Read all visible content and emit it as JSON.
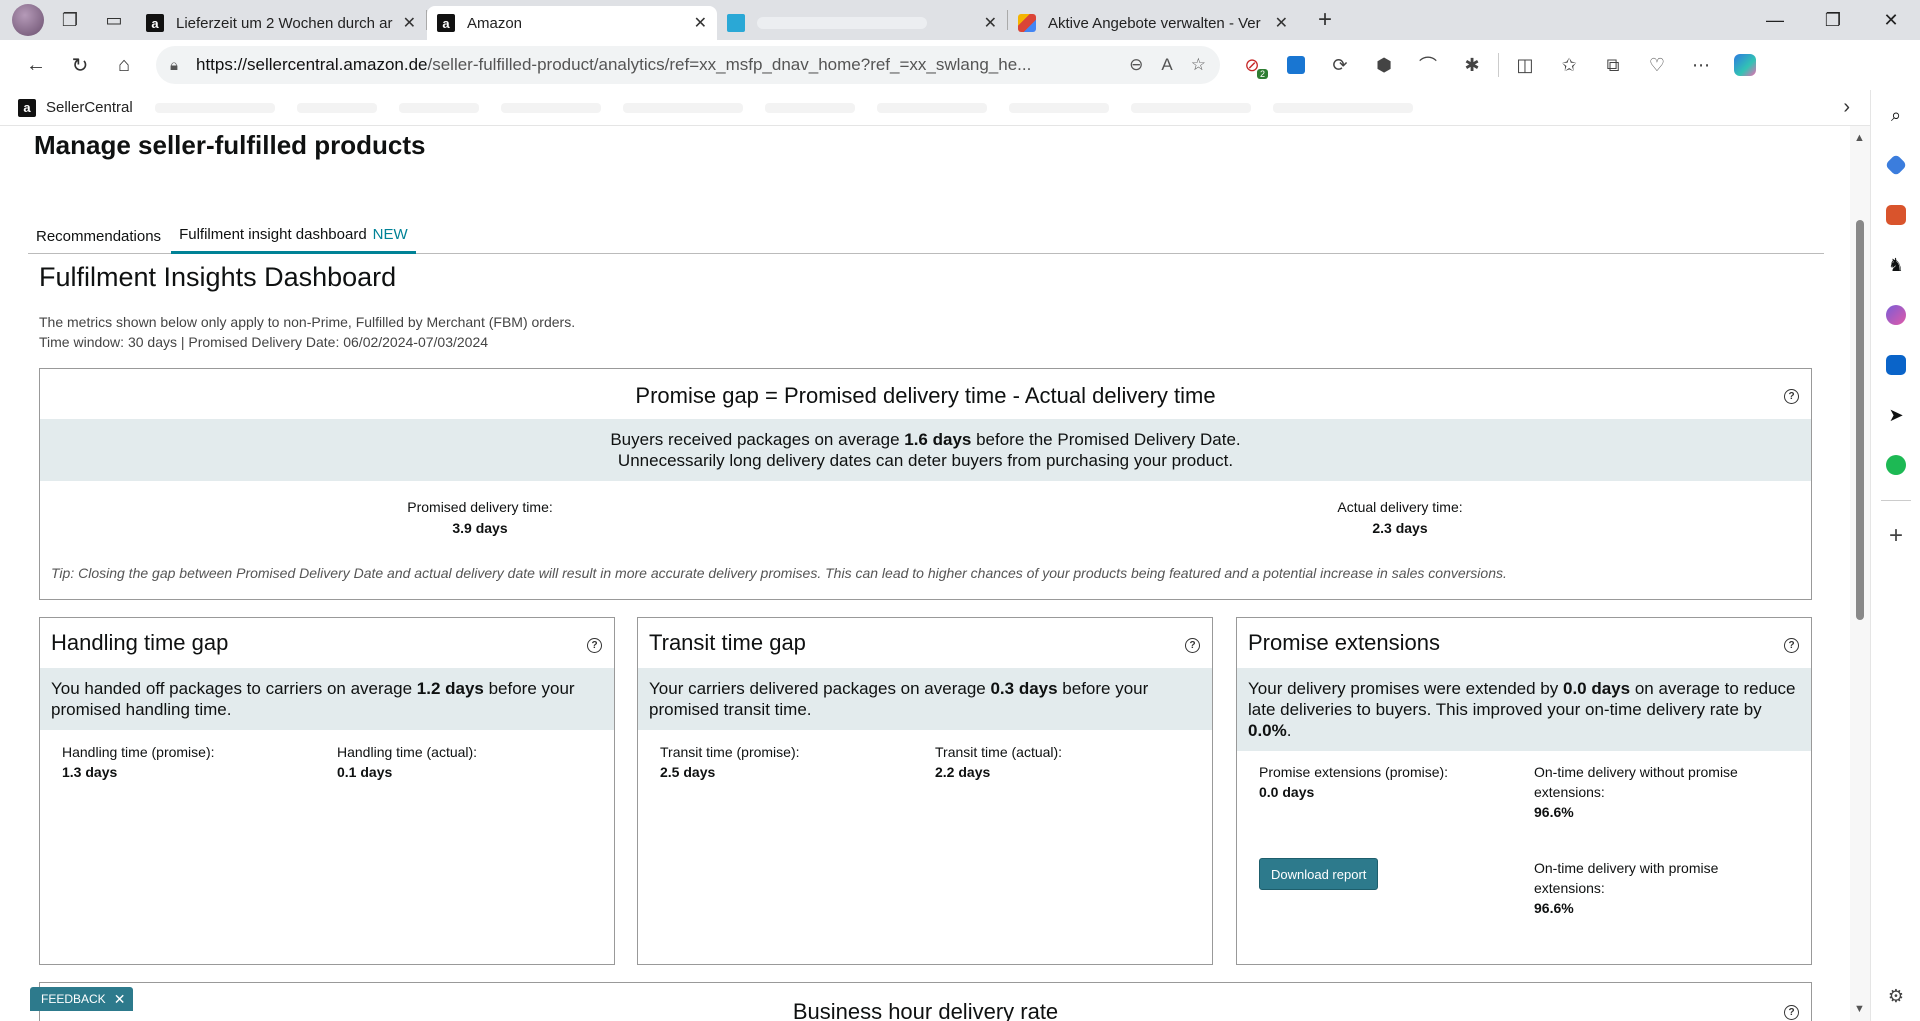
{
  "browser": {
    "tabs": [
      {
        "title": "Lieferzeit um 2 Wochen durch ar",
        "favicon": "amazon",
        "active": false
      },
      {
        "title": "Amazon",
        "favicon": "amazon",
        "active": true
      },
      {
        "title": "",
        "favicon": "sellercentral",
        "active": false
      },
      {
        "title": "Aktive Angebote verwalten - Ver",
        "favicon": "shopping-bag",
        "active": false
      }
    ],
    "url_host": "https://sellercentral.amazon.de",
    "url_path": "/seller-fulfilled-product/analytics/ref=xx_msfp_dnav_home?ref_=xx_swlang_he...",
    "ext_badge": "2",
    "favorites": {
      "first": "SellerCentral"
    }
  },
  "page": {
    "title": "Manage seller-fulfilled products",
    "tabs": [
      {
        "label": "Recommendations",
        "tag": ""
      },
      {
        "label": "Fulfilment insight dashboard",
        "tag": "NEW"
      }
    ],
    "dashboard_title": "Fulfilment Insights Dashboard",
    "desc_line1": "The metrics shown below only apply to non-Prime, Fulfilled by Merchant (FBM) orders.",
    "desc_line2": "Time window: 30 days | Promised Delivery Date: 06/02/2024-07/03/2024",
    "promise_gap": {
      "heading": "Promise gap = Promised delivery time - Actual delivery time",
      "band_pre": "Buyers received packages on average ",
      "band_value": "1.6 days",
      "band_post": " before the Promised Delivery Date.",
      "band_line2": "Unnecessarily long delivery dates can deter buyers from purchasing your product.",
      "promised_label": "Promised delivery time:",
      "promised_value": "3.9 days",
      "actual_label": "Actual delivery time:",
      "actual_value": "2.3 days",
      "tip": "Tip: Closing the gap between Promised Delivery Date and actual delivery date will result in more accurate delivery promises. This can lead to higher chances of your products being featured and a potential increase in sales conversions."
    },
    "handling": {
      "title": "Handling time gap",
      "band_pre": "You handed off packages to carriers on average ",
      "band_value": "1.2 days",
      "band_post": " before your promised handling time.",
      "m1_label": "Handling time (promise):",
      "m1_value": "1.3 days",
      "m2_label": "Handling time (actual):",
      "m2_value": "0.1 days"
    },
    "transit": {
      "title": "Transit time gap",
      "band_pre": "Your carriers delivered packages on average ",
      "band_value": "0.3 days",
      "band_post": " before your promised transit time.",
      "m1_label": "Transit time (promise):",
      "m1_value": "2.5 days",
      "m2_label": "Transit time (actual):",
      "m2_value": "2.2 days"
    },
    "extensions": {
      "title": "Promise extensions",
      "band_pre": "Your delivery promises were extended by ",
      "band_value": "0.0 days",
      "band_mid": " on average to reduce late deliveries to buyers. This improved your on-time delivery rate by ",
      "band_value2": "0.0%",
      "band_post": ".",
      "m1_label": "Promise extensions (promise):",
      "m1_value": "0.0 days",
      "m2_label": "On-time delivery without promise extensions:",
      "m2_value": "96.6%",
      "m3_label": "On-time delivery with promise extensions:",
      "m3_value": "96.6%",
      "download_label": "Download report"
    },
    "business_hour_title": "Business hour delivery rate",
    "feedback_label": "FEEDBACK"
  }
}
